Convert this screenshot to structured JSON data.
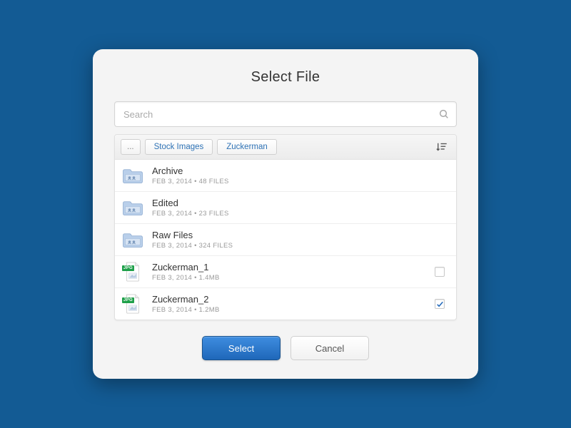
{
  "title": "Select File",
  "search": {
    "placeholder": "Search"
  },
  "breadcrumbs": {
    "root": "...",
    "items": [
      "Stock Images",
      "Zuckerman"
    ]
  },
  "rows": [
    {
      "type": "folder",
      "name": "Archive",
      "date": "FEB 3, 2014",
      "meta": "48 FILES"
    },
    {
      "type": "folder",
      "name": "Edited",
      "date": "FEB 3, 2014",
      "meta": "23 FILES"
    },
    {
      "type": "folder",
      "name": "Raw Files",
      "date": "FEB 3, 2014",
      "meta": "324 FILES"
    },
    {
      "type": "file",
      "name": "Zuckerman_1",
      "date": "FEB 3, 2014",
      "meta": "1.4MB",
      "badge": "JPG",
      "checked": false
    },
    {
      "type": "file",
      "name": "Zuckerman_2",
      "date": "FEB 3, 2014",
      "meta": "1.2MB",
      "badge": "JPG",
      "checked": true
    }
  ],
  "actions": {
    "select": "Select",
    "cancel": "Cancel"
  }
}
